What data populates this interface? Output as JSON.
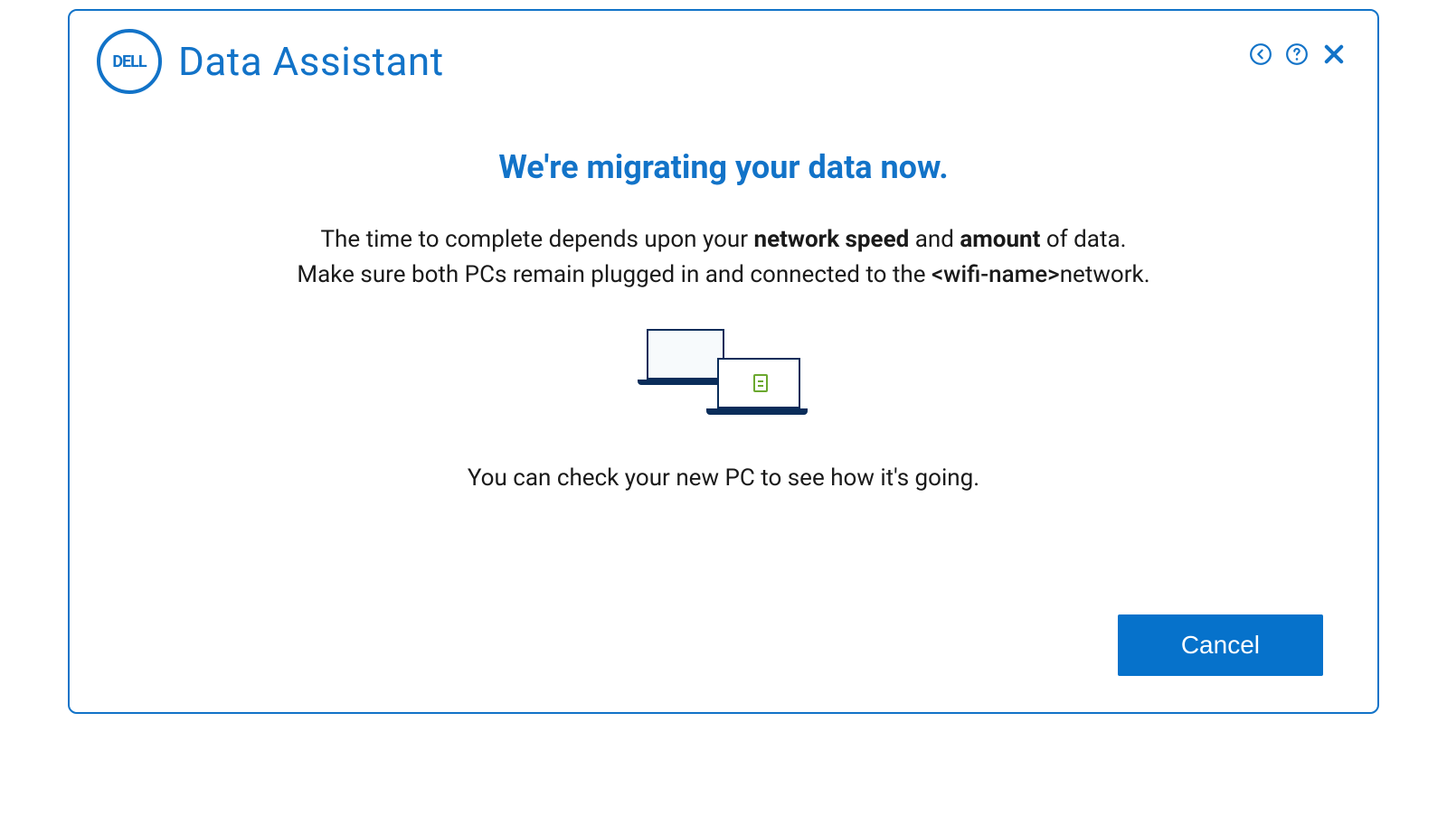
{
  "header": {
    "app_title": "Data Assistant",
    "logo_text": "DELL"
  },
  "content": {
    "headline": "We're migrating your data now.",
    "body_pre": "The time to complete depends upon your ",
    "body_bold1": "network speed",
    "body_mid1": " and ",
    "body_bold2": "amount",
    "body_mid2": " of data.",
    "body_line2a": "Make sure both PCs remain plugged in and connected to the ",
    "body_wifi": "<wifi-name>",
    "body_line2b": "network.",
    "sub_text": "You can check your new PC to see how it's going."
  },
  "footer": {
    "cancel_label": "Cancel"
  }
}
